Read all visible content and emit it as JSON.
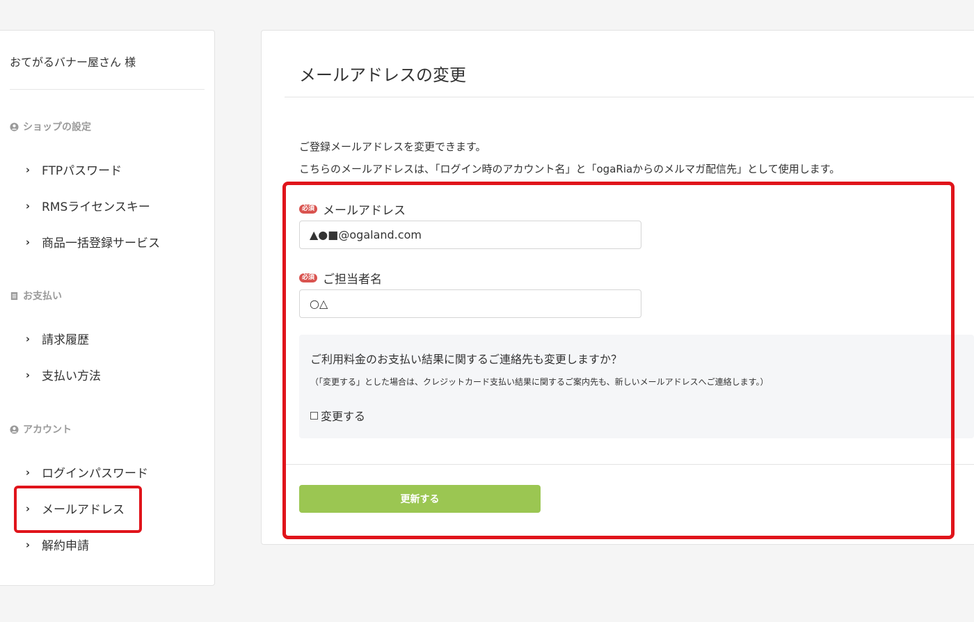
{
  "sidebar": {
    "shop_name": "おてがるバナー屋さん 様",
    "sections": [
      {
        "heading": "ショップの設定",
        "icon": "user-circle-icon",
        "items": [
          "FTPパスワード",
          "RMSライセンスキー",
          "商品一括登録サービス"
        ]
      },
      {
        "heading": "お支払い",
        "icon": "receipt-icon",
        "items": [
          "請求履歴",
          "支払い方法"
        ]
      },
      {
        "heading": "アカウント",
        "icon": "user-circle-icon",
        "items": [
          "ログインパスワード",
          "メールアドレス",
          "解約申請"
        ]
      }
    ],
    "active_item": "メールアドレス"
  },
  "main": {
    "title": "メールアドレスの変更",
    "description": [
      "ご登録メールアドレスを変更できます。",
      "こちらのメールアドレスは、「ログイン時のアカウント名」と「ogaRiaからのメルマガ配信先」として使用します。"
    ],
    "required_badge": "必須",
    "email_label": "メールアドレス",
    "email_value": "▲●■@ogaland.com",
    "contact_label": "ご担当者名",
    "contact_value": "○△",
    "notice_question": "ご利用料金のお支払い結果に関するご連絡先も変更しますか？",
    "notice_note": "（「変更する」とした場合は、クレジットカード支払い結果に関するご案内先も、新しいメールアドレスへご連絡します。）",
    "checkbox_label": "変更する",
    "checkbox_checked": false,
    "submit_label": "更新する"
  },
  "colors": {
    "highlight": "#e0141b",
    "submit": "#9bc652",
    "required_badge": "#d9534f"
  }
}
